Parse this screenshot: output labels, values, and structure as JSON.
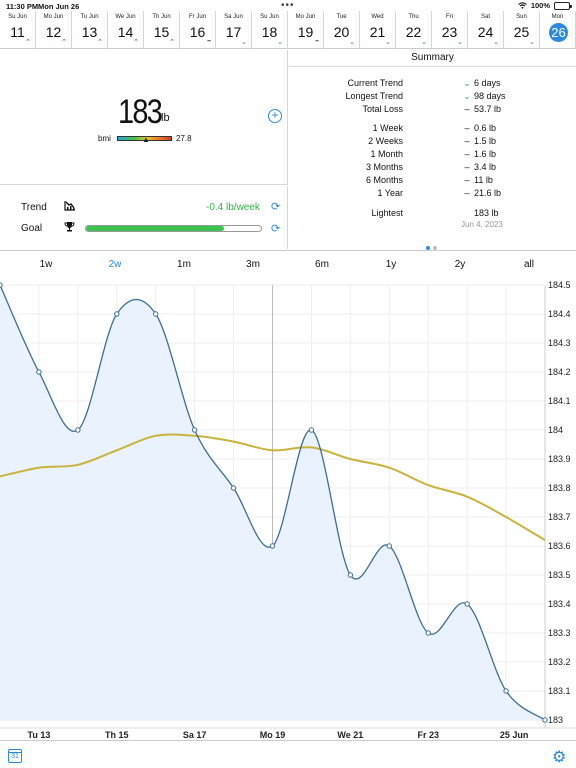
{
  "status": {
    "time": "11:30 PM",
    "date": "Mon Jun 26",
    "battery": "100%"
  },
  "days": [
    {
      "dn": "Su Jun",
      "num": "11",
      "mark": "up"
    },
    {
      "dn": "Mo Jun",
      "num": "12",
      "mark": "up"
    },
    {
      "dn": "Tu Jun",
      "num": "13",
      "mark": "up"
    },
    {
      "dn": "We Jun",
      "num": "14",
      "mark": "up"
    },
    {
      "dn": "Th Jun",
      "num": "15",
      "mark": "up"
    },
    {
      "dn": "Fr Jun",
      "num": "16",
      "mark": "flat"
    },
    {
      "dn": "Sa Jun",
      "num": "17",
      "mark": "down"
    },
    {
      "dn": "Su Jun",
      "num": "18",
      "mark": "down"
    },
    {
      "dn": "Mo Jun",
      "num": "19",
      "mark": "flat"
    },
    {
      "dn": "Tue",
      "num": "20",
      "mark": "down"
    },
    {
      "dn": "Wed",
      "num": "21",
      "mark": "down"
    },
    {
      "dn": "Thu",
      "num": "22",
      "mark": "down"
    },
    {
      "dn": "Fri",
      "num": "23",
      "mark": "down"
    },
    {
      "dn": "Sat",
      "num": "24",
      "mark": "down"
    },
    {
      "dn": "Sun",
      "num": "25",
      "mark": "down"
    },
    {
      "dn": "Mon",
      "num": "26",
      "mark": "none",
      "selected": true
    }
  ],
  "weight": {
    "value": "183",
    "unit": "lb",
    "bmi_label": "bmi",
    "bmi_value": "27.8"
  },
  "trend": {
    "label": "Trend",
    "value": "-0.4 lb/week"
  },
  "goal": {
    "label": "Goal",
    "progress": 0.79
  },
  "summary": {
    "title": "Summary",
    "rows": [
      {
        "k": "Current Trend",
        "s": "⌄",
        "v": "6 days",
        "down": true
      },
      {
        "k": "Longest Trend",
        "s": "⌄",
        "v": "98 days",
        "down": true
      },
      {
        "k": "Total Loss",
        "s": "–",
        "v": "53.7 lb"
      },
      {
        "k": "1 Week",
        "s": "–",
        "v": "0.6 lb"
      },
      {
        "k": "2 Weeks",
        "s": "–",
        "v": "1.5 lb"
      },
      {
        "k": "1 Month",
        "s": "–",
        "v": "1.6 lb"
      },
      {
        "k": "3 Months",
        "s": "–",
        "v": "3.4 lb"
      },
      {
        "k": "6 Months",
        "s": "–",
        "v": "11 lb"
      },
      {
        "k": "1 Year",
        "s": "–",
        "v": "21.6 lb"
      },
      {
        "k": "Lightest",
        "s": "",
        "v": "183 lb"
      }
    ],
    "lightest_date": "Jun 4, 2023"
  },
  "tabs": [
    "1w",
    "2w",
    "1m",
    "3m",
    "6m",
    "1y",
    "2y",
    "all"
  ],
  "active_tab": "2w",
  "bottom": {
    "calendar_day": "31"
  },
  "colors": {
    "accent": "#2b8ae0",
    "up": "#e0403a",
    "down": "#35b24a",
    "weight_line": "#3d6d96",
    "trend_line": "#c9b33c",
    "fill": "#eaf3fd"
  },
  "chart_data": {
    "type": "line",
    "ylim": [
      183.0,
      184.5
    ],
    "y_ticks": [
      "184.5",
      "184.4",
      "184.3",
      "184.2",
      "184.1",
      "184",
      "183.9",
      "183.8",
      "183.7",
      "183.6",
      "183.5",
      "183.4",
      "183.3",
      "183.2",
      "183.1",
      "183"
    ],
    "x_day_range": [
      12,
      26
    ],
    "x_labels": [
      {
        "day": 13,
        "label": "Tu 13"
      },
      {
        "day": 15,
        "label": "Th 15"
      },
      {
        "day": 17,
        "label": "Sa 17"
      },
      {
        "day": 19,
        "label": "Mo 19"
      },
      {
        "day": 21,
        "label": "We 21"
      },
      {
        "day": 23,
        "label": "Fr 23"
      },
      {
        "day": 25,
        "label": "25 Jun"
      }
    ],
    "series": [
      {
        "type": "weight",
        "x": [
          12,
          13,
          14,
          15,
          16,
          17,
          18,
          19,
          20,
          21,
          22,
          23,
          24,
          25,
          26
        ],
        "values": [
          184.5,
          184.2,
          184.0,
          184.4,
          184.4,
          184.0,
          183.8,
          183.6,
          184.0,
          183.5,
          183.6,
          183.3,
          183.4,
          183.1,
          183.0
        ]
      },
      {
        "type": "trend",
        "x": [
          12,
          13,
          14,
          15,
          16,
          17,
          18,
          19,
          20,
          21,
          22,
          23,
          24,
          25,
          26
        ],
        "values": [
          183.84,
          183.87,
          183.88,
          183.93,
          183.98,
          183.98,
          183.96,
          183.93,
          183.94,
          183.9,
          183.87,
          183.81,
          183.77,
          183.7,
          183.62
        ]
      }
    ]
  }
}
